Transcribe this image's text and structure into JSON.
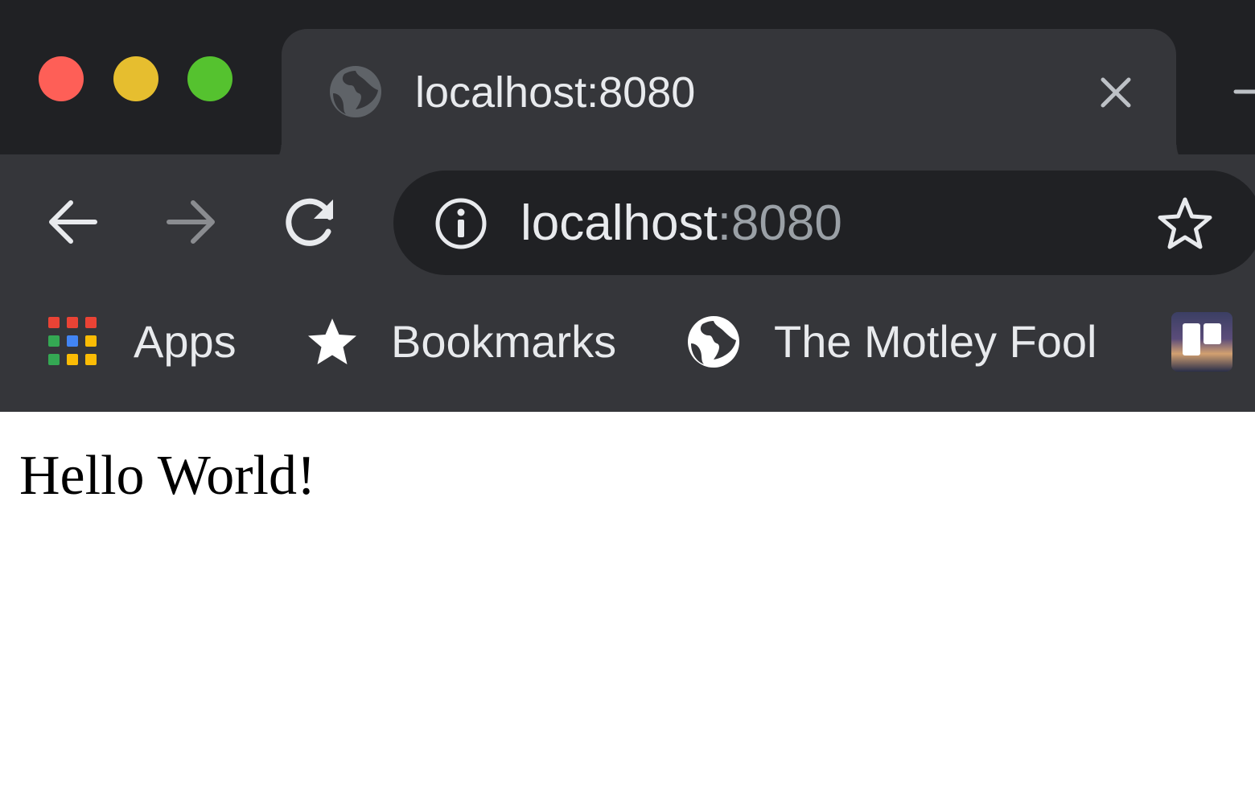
{
  "window": {
    "traffic_lights": {
      "close_color": "#fe5f57",
      "minimize_color": "#e6be2f",
      "zoom_color": "#55c22f"
    }
  },
  "tab": {
    "title": "localhost:8080",
    "favicon": "globe-icon",
    "close_icon": "close-icon"
  },
  "toolbar": {
    "back_icon": "arrow-left-icon",
    "forward_icon": "arrow-right-icon",
    "reload_icon": "reload-icon"
  },
  "omnibox": {
    "info_icon": "info-icon",
    "url_host": "localhost",
    "url_port": ":8080",
    "bookmark_icon": "star-outline-icon"
  },
  "bookmarks_bar": {
    "items": [
      {
        "label": "Apps",
        "icon": "apps-grid-icon"
      },
      {
        "label": "Bookmarks",
        "icon": "star-icon"
      },
      {
        "label": "The Motley Fool",
        "icon": "globe-icon"
      },
      {
        "label": "",
        "icon": "trello-icon"
      }
    ]
  },
  "page": {
    "text": "Hello World!"
  },
  "colors": {
    "frame_dark": "#202124",
    "frame_light": "#35363a",
    "text_light": "#e8eaed",
    "text_dim": "#9aa0a6"
  }
}
